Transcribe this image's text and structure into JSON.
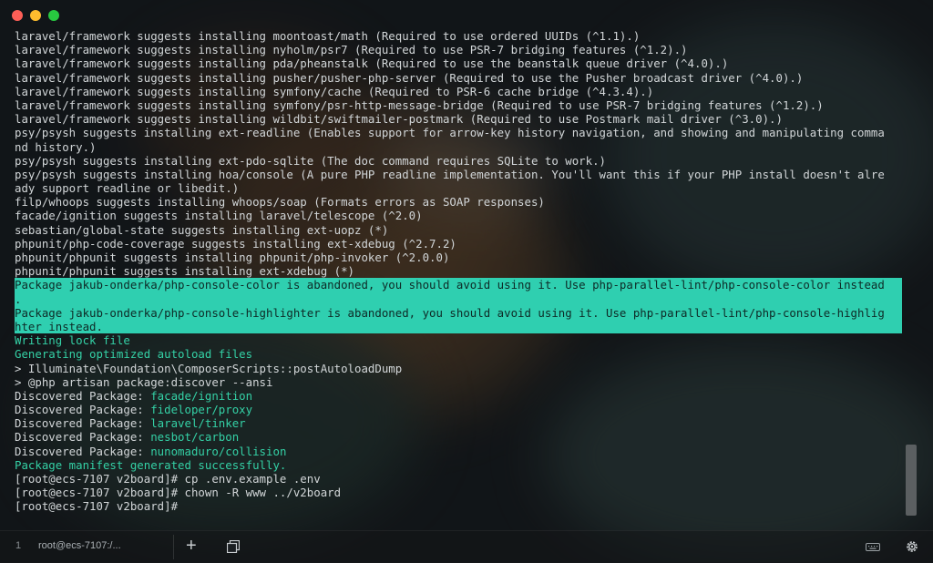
{
  "window": {
    "tab_number": "1",
    "tab_title": "root@ecs-7107:/...",
    "new_tab_label": "+"
  },
  "terminal": {
    "lines": [
      {
        "text": "laravel/framework suggests installing moontoast/math (Required to use ordered UUIDs (^1.1).)",
        "style": "normal"
      },
      {
        "text": "laravel/framework suggests installing nyholm/psr7 (Required to use PSR-7 bridging features (^1.2).)",
        "style": "normal"
      },
      {
        "text": "laravel/framework suggests installing pda/pheanstalk (Required to use the beanstalk queue driver (^4.0).)",
        "style": "normal"
      },
      {
        "text": "laravel/framework suggests installing pusher/pusher-php-server (Required to use the Pusher broadcast driver (^4.0).)",
        "style": "normal"
      },
      {
        "text": "laravel/framework suggests installing symfony/cache (Required to PSR-6 cache bridge (^4.3.4).)",
        "style": "normal"
      },
      {
        "text": "laravel/framework suggests installing symfony/psr-http-message-bridge (Required to use PSR-7 bridging features (^1.2).)",
        "style": "normal"
      },
      {
        "text": "laravel/framework suggests installing wildbit/swiftmailer-postmark (Required to use Postmark mail driver (^3.0).)",
        "style": "normal"
      },
      {
        "text": "psy/psysh suggests installing ext-readline (Enables support for arrow-key history navigation, and showing and manipulating comma",
        "style": "normal"
      },
      {
        "text": "nd history.)",
        "style": "normal"
      },
      {
        "text": "psy/psysh suggests installing ext-pdo-sqlite (The doc command requires SQLite to work.)",
        "style": "normal"
      },
      {
        "text": "psy/psysh suggests installing hoa/console (A pure PHP readline implementation. You'll want this if your PHP install doesn't alre",
        "style": "normal"
      },
      {
        "text": "ady support readline or libedit.)",
        "style": "normal"
      },
      {
        "text": "filp/whoops suggests installing whoops/soap (Formats errors as SOAP responses)",
        "style": "normal"
      },
      {
        "text": "facade/ignition suggests installing laravel/telescope (^2.0)",
        "style": "normal"
      },
      {
        "text": "sebastian/global-state suggests installing ext-uopz (*)",
        "style": "normal"
      },
      {
        "text": "phpunit/php-code-coverage suggests installing ext-xdebug (^2.7.2)",
        "style": "normal"
      },
      {
        "text": "phpunit/phpunit suggests installing phpunit/php-invoker (^2.0.0)",
        "style": "normal"
      },
      {
        "text": "phpunit/phpunit suggests installing ext-xdebug (*)",
        "style": "normal"
      },
      {
        "text": "Package jakub-onderka/php-console-color is abandoned, you should avoid using it. Use php-parallel-lint/php-console-color instead",
        "style": "highlight"
      },
      {
        "text": ".",
        "style": "highlight"
      },
      {
        "text": "Package jakub-onderka/php-console-highlighter is abandoned, you should avoid using it. Use php-parallel-lint/php-console-highlig",
        "style": "highlight"
      },
      {
        "text": "hter instead.",
        "style": "highlight"
      },
      {
        "text": "Writing lock file",
        "style": "green"
      },
      {
        "text": "Generating optimized autoload files",
        "style": "green"
      },
      {
        "text": "> Illuminate\\Foundation\\ComposerScripts::postAutoloadDump",
        "style": "normal"
      },
      {
        "text": "> @php artisan package:discover --ansi",
        "style": "normal"
      },
      {
        "prefix": "Discovered Package: ",
        "text": "facade/ignition",
        "style": "discovered"
      },
      {
        "prefix": "Discovered Package: ",
        "text": "fideloper/proxy",
        "style": "discovered"
      },
      {
        "prefix": "Discovered Package: ",
        "text": "laravel/tinker",
        "style": "discovered"
      },
      {
        "prefix": "Discovered Package: ",
        "text": "nesbot/carbon",
        "style": "discovered"
      },
      {
        "prefix": "Discovered Package: ",
        "text": "nunomaduro/collision",
        "style": "discovered"
      },
      {
        "text": "Package manifest generated successfully.",
        "style": "green"
      },
      {
        "text": "[root@ecs-7107 v2board]# cp .env.example .env",
        "style": "normal"
      },
      {
        "text": "[root@ecs-7107 v2board]# chown -R www ../v2board",
        "style": "normal"
      },
      {
        "text": "[root@ecs-7107 v2board]# ",
        "style": "normal"
      }
    ]
  },
  "icons": {
    "duplicate": "copy-icon",
    "keyboard": "keyboard-icon",
    "settings": "gear-icon"
  },
  "colors": {
    "highlight_bg": "#2fcfb0",
    "green_text": "#34d1a6",
    "text": "#d2d6d8"
  }
}
